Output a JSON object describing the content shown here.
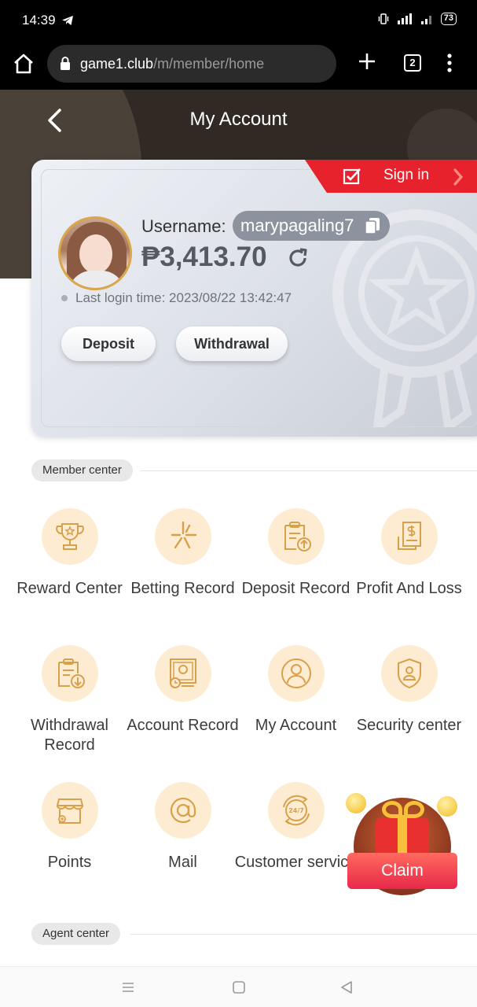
{
  "status_bar": {
    "time": "14:39",
    "battery": "73"
  },
  "browser": {
    "url_host": "game1.club",
    "url_path": "/m/member/home",
    "tab_count": "2"
  },
  "header": {
    "title": "My Account"
  },
  "card": {
    "signin_label": "Sign in",
    "username_label": "Username:",
    "username": "marypagaling7",
    "balance": "₱3,413.70",
    "last_login": "Last login time: 2023/08/22 13:42:47",
    "deposit_label": "Deposit",
    "withdrawal_label": "Withdrawal"
  },
  "member_center": {
    "label": "Member center",
    "items": [
      {
        "label": "Reward Center",
        "icon": "trophy-icon"
      },
      {
        "label": "Betting Record",
        "icon": "sparkle-icon"
      },
      {
        "label": "Deposit Record",
        "icon": "clipboard-upload-icon"
      },
      {
        "label": "Profit And Loss",
        "icon": "dollar-document-icon"
      },
      {
        "label": "Withdrawal Record",
        "icon": "clipboard-download-icon"
      },
      {
        "label": "Account Record",
        "icon": "account-record-icon"
      },
      {
        "label": "My Account",
        "icon": "user-icon"
      },
      {
        "label": "Security center",
        "icon": "shield-user-icon"
      },
      {
        "label": "Points",
        "icon": "store-icon"
      },
      {
        "label": "Mail",
        "icon": "at-icon"
      },
      {
        "label": "Customer service",
        "icon": "24-7-icon"
      }
    ]
  },
  "claim": {
    "label": "Claim"
  },
  "agent_center": {
    "label": "Agent center"
  },
  "colors": {
    "accent_red": "#e8222d",
    "icon_bg": "#fdecd2",
    "icon_stroke": "#d9a04a"
  }
}
